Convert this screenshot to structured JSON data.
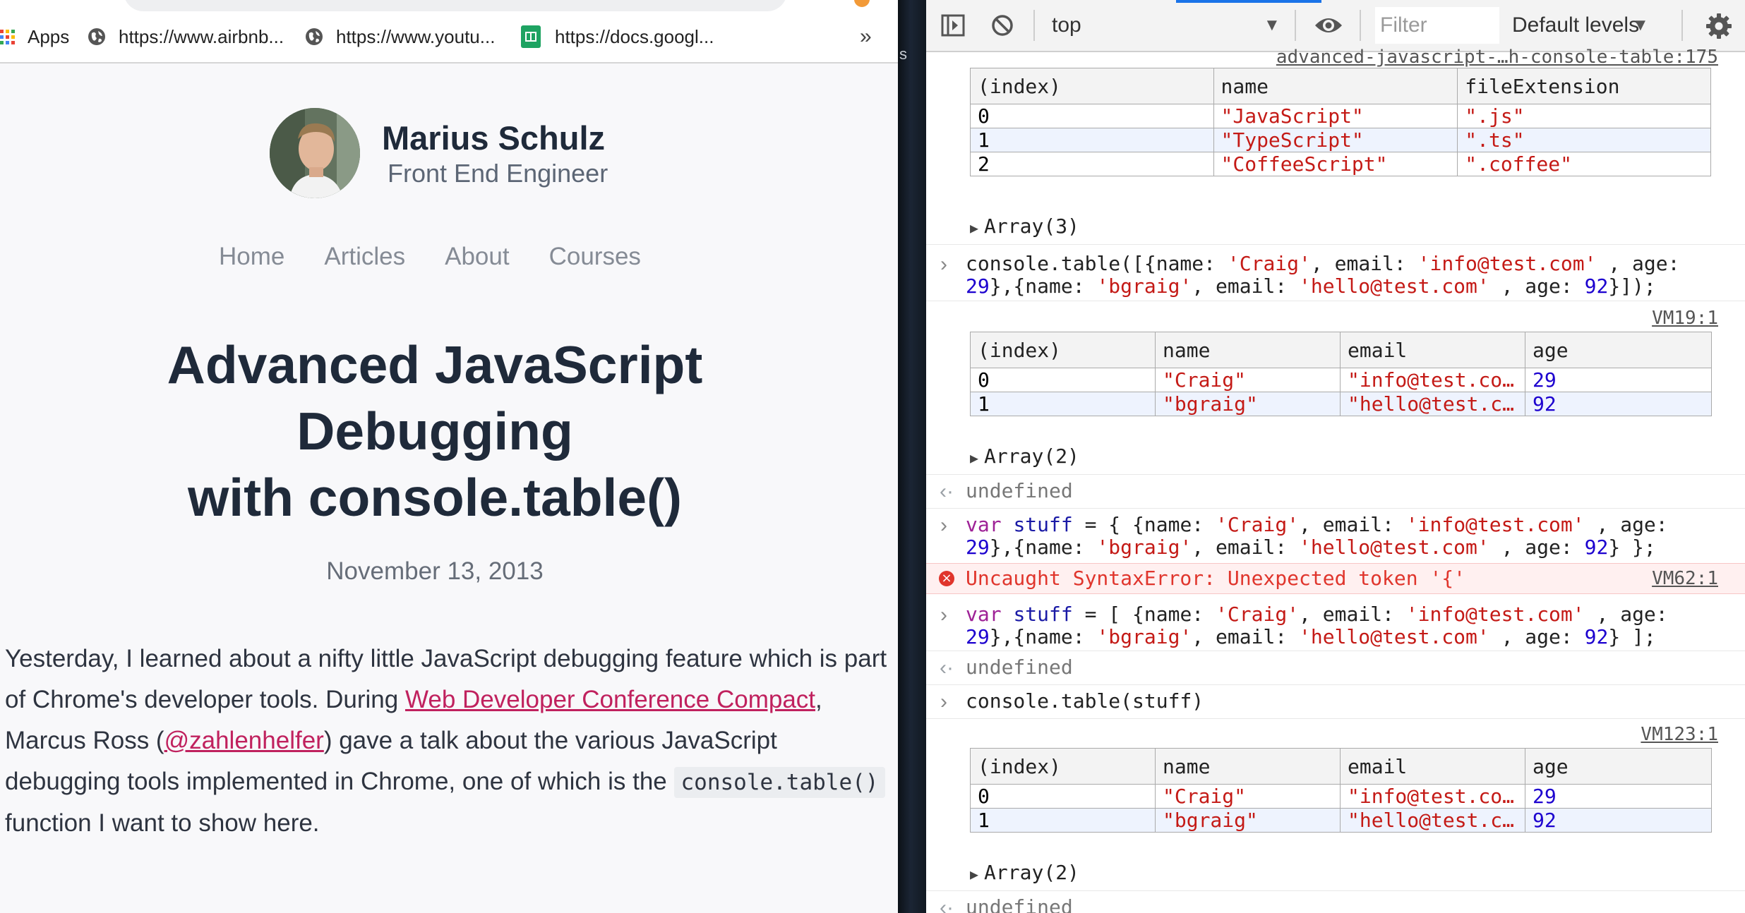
{
  "bookmarks": {
    "apps_label": "Apps",
    "items": [
      {
        "label": "https://www.airbnb...",
        "icon": "globe-icon"
      },
      {
        "label": "https://www.youtu...",
        "icon": "globe-icon"
      },
      {
        "label": "https://docs.googl...",
        "icon": "google-sheets-icon"
      }
    ],
    "overflow_label": "»"
  },
  "blog": {
    "author_name": "Marius Schulz",
    "author_role": "Front End Engineer",
    "nav": [
      "Home",
      "Articles",
      "About",
      "Courses"
    ],
    "title_line1": "Advanced JavaScript",
    "title_line2": "Debugging",
    "title_line3": "with console.table()",
    "date": "November 13, 2013",
    "intro": {
      "p1": "Yesterday, I learned about a nifty little JavaScript debugging feature which is part of Chrome's developer tools. During ",
      "link1": "Web Developer Conference Compact",
      "p2": ", Marcus Ross (",
      "link2": "@zahlenhelfer",
      "p3": ") gave a talk about the various JavaScript debugging tools implemented in Chrome, one of which is the ",
      "code": "console.table()",
      "p4": " function I want to show here."
    }
  },
  "divider_text": "s",
  "devtools": {
    "context": "top",
    "filter_placeholder": "Filter",
    "levels": "Default levels",
    "entries": {
      "source0": "advanced-javascript-…h-console-table:175",
      "table1": {
        "headers": [
          "(index)",
          "name",
          "fileExtension"
        ],
        "rows": [
          [
            "0",
            "\"JavaScript\"",
            "\".js\""
          ],
          [
            "1",
            "\"TypeScript\"",
            "\".ts\""
          ],
          [
            "2",
            "\"CoffeeScript\"",
            "\".coffee\""
          ]
        ]
      },
      "array1": "Array(3)",
      "cmd1": {
        "a": "console.table([{name: ",
        "b": "'Craig'",
        "c": ", email: ",
        "d": "'info@test.com'",
        "e": " , age:",
        "f": "29",
        "g": "},{name: ",
        "h": "'bgraig'",
        "i": ", email: ",
        "j": "'hello@test.com'",
        "k": " , age: ",
        "l": "92",
        "m": "}]);"
      },
      "source1": "VM19:1",
      "table2": {
        "headers": [
          "(index)",
          "name",
          "email",
          "age"
        ],
        "rows": [
          [
            "0",
            "\"Craig\"",
            "\"info@test.co…",
            "29"
          ],
          [
            "1",
            "\"bgraig\"",
            "\"hello@test.c…",
            "92"
          ]
        ]
      },
      "array2": "Array(2)",
      "undefined": "undefined",
      "cmd2": {
        "kw": "var",
        "var": "stuff",
        "a": " = { {name: ",
        "b": "'Craig'",
        "c": ", email: ",
        "d": "'info@test.com'",
        "e": " , age:",
        "f": "29",
        "g": "},{name: ",
        "h": "'bgraig'",
        "i": ", email: ",
        "j": "'hello@test.com'",
        "k": " , age: ",
        "l": "92",
        "m": "} };"
      },
      "error": "Uncaught SyntaxError: Unexpected token '{'",
      "error_source": "VM62:1",
      "cmd3": {
        "kw": "var",
        "var": "stuff",
        "a": " = [ {name: ",
        "b": "'Craig'",
        "c": ", email: ",
        "d": "'info@test.com'",
        "e": " , age:",
        "f": "29",
        "g": "},{name: ",
        "h": "'bgraig'",
        "i": ", email: ",
        "j": "'hello@test.com'",
        "k": " , age: ",
        "l": "92",
        "m": "} ];"
      },
      "cmd4": "console.table(stuff)",
      "source4": "VM123:1",
      "array3": "Array(2)"
    }
  }
}
